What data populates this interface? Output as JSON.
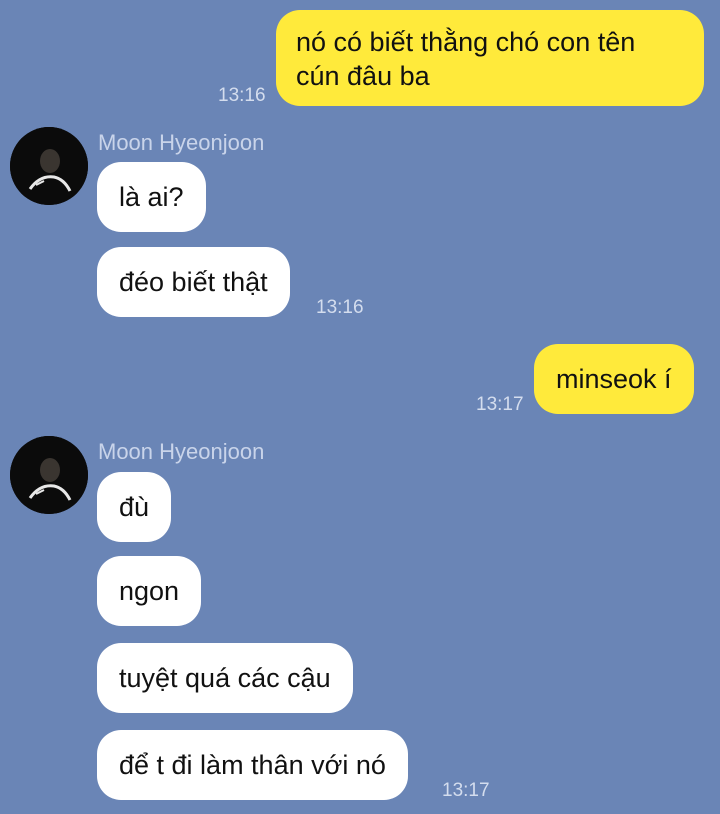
{
  "chat": {
    "background": "#6A85B6",
    "outgoing_color": "#FFEA3B",
    "incoming_color": "#FFFFFF",
    "messages": [
      {
        "direction": "out",
        "text_line1": "nó có biết thằng chó con tên",
        "text_line2": "cún đâu ba",
        "time": "13:16"
      },
      {
        "direction": "in",
        "sender": "Moon Hyeonjoon",
        "text": "là ai?"
      },
      {
        "direction": "in",
        "text": "đéo biết thật",
        "time": "13:16"
      },
      {
        "direction": "out",
        "text": "minseok í",
        "time": "13:17"
      },
      {
        "direction": "in",
        "sender": "Moon Hyeonjoon",
        "text": "đù"
      },
      {
        "direction": "in",
        "text": "ngon"
      },
      {
        "direction": "in",
        "text": "tuyệt quá các cậu"
      },
      {
        "direction": "in",
        "text": "để t đi làm thân với nó",
        "time": "13:17"
      }
    ]
  }
}
